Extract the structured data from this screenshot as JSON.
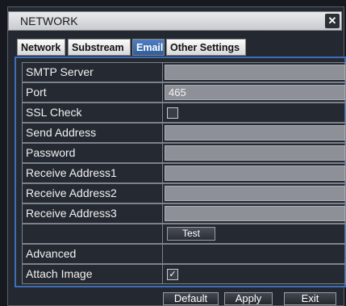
{
  "window": {
    "title": "NETWORK",
    "close_glyph": "✕"
  },
  "tabs": [
    {
      "label": "Network",
      "active": false
    },
    {
      "label": "Substream",
      "active": false
    },
    {
      "label": "Email",
      "active": true
    },
    {
      "label": "Other Settings",
      "active": false
    }
  ],
  "form": {
    "smtp_server": {
      "label": "SMTP Server",
      "value": ""
    },
    "port": {
      "label": "Port",
      "value": "465"
    },
    "ssl_check": {
      "label": "SSL Check",
      "checked": false,
      "glyph": ""
    },
    "send_address": {
      "label": "Send Address",
      "value": ""
    },
    "password": {
      "label": "Password",
      "value": ""
    },
    "receive1": {
      "label": "Receive Address1",
      "value": ""
    },
    "receive2": {
      "label": "Receive Address2",
      "value": ""
    },
    "receive3": {
      "label": "Receive Address3",
      "value": ""
    },
    "test_button": "Test",
    "advanced": {
      "label": "Advanced"
    },
    "attach_image": {
      "label": "Attach Image",
      "checked": true,
      "glyph": "✓"
    }
  },
  "buttons": {
    "default": "Default",
    "apply": "Apply",
    "exit": "Exit"
  }
}
